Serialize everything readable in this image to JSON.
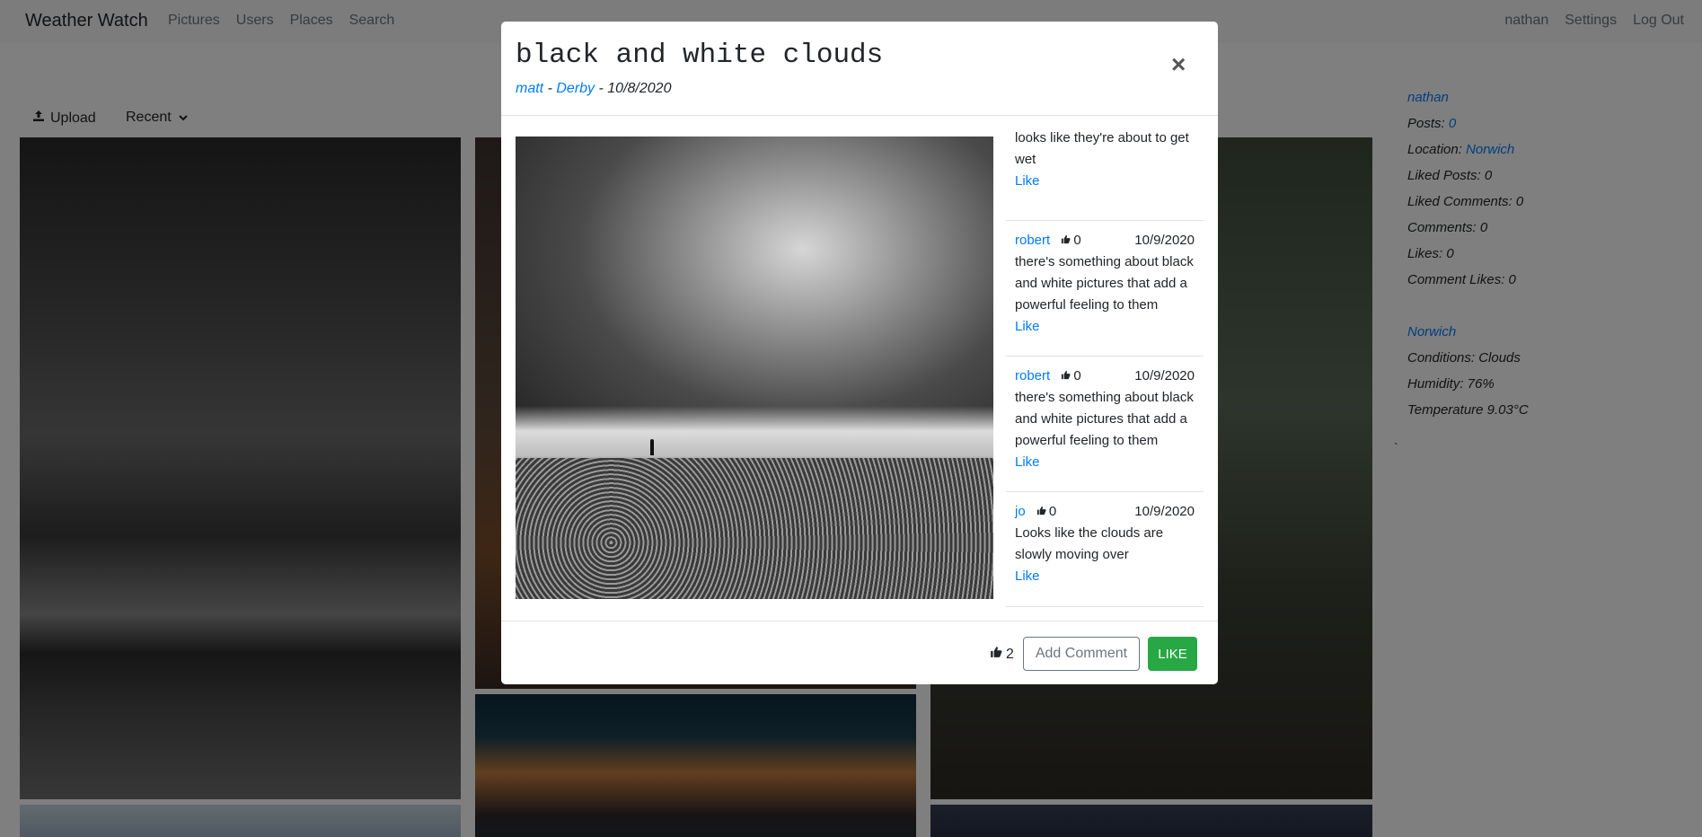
{
  "navbar": {
    "brand": "Weather Watch",
    "links": [
      "Pictures",
      "Users",
      "Places",
      "Search"
    ],
    "right_links": [
      "nathan",
      "Settings",
      "Log Out"
    ]
  },
  "toolbar": {
    "upload_label": "Upload",
    "sort_label": "Recent"
  },
  "sidebar": {
    "username": "nathan",
    "posts_label": "Posts:",
    "posts_value": "0",
    "location_label": "Location:",
    "location_value": "Norwich",
    "liked_posts": "Liked Posts: 0",
    "liked_comments": "Liked Comments: 0",
    "comments": "Comments: 0",
    "likes": "Likes: 0",
    "comment_likes": "Comment Likes: 0",
    "weather_place": "Norwich",
    "conditions": "Conditions: Clouds",
    "humidity": "Humidity: 76%",
    "temperature": "Temperature 9.03°C",
    "stray_mark": "`"
  },
  "modal": {
    "title": "black and white clouds",
    "author": "matt",
    "separator": "-",
    "location": "Derby",
    "date": "10/8/2020",
    "close_symbol": "×",
    "comments": [
      {
        "text": "looks like they're about to get wet",
        "like_label": "Like"
      },
      {
        "author": "robert",
        "likes": "0",
        "date": "10/9/2020",
        "text": "there's something about black and white pictures that add a powerful feeling to them",
        "like_label": "Like"
      },
      {
        "author": "robert",
        "likes": "0",
        "date": "10/9/2020",
        "text": "there's something about black and white pictures that add a powerful feeling to them",
        "like_label": "Like"
      },
      {
        "author": "jo",
        "likes": "0",
        "date": "10/9/2020",
        "text": "Looks like the clouds are slowly moving over",
        "like_label": "Like"
      }
    ],
    "footer": {
      "like_count": "2",
      "add_comment_label": "Add Comment",
      "like_button_label": "LIKE"
    }
  },
  "colors": {
    "link": "#007bff",
    "like_button": "#28a745"
  }
}
